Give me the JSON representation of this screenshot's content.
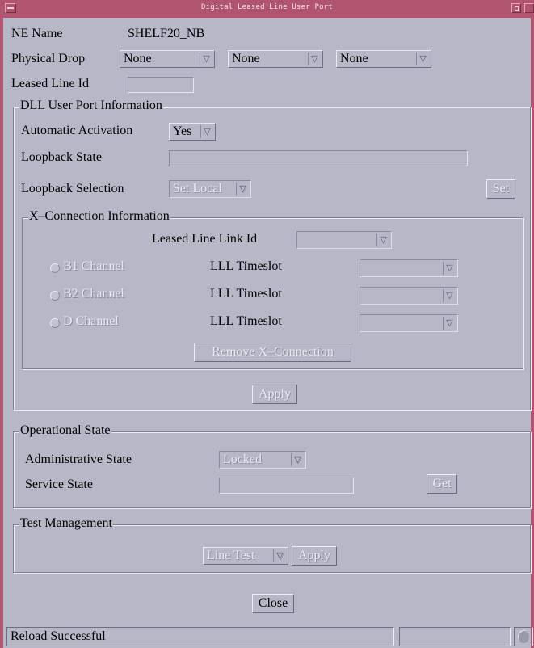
{
  "window": {
    "title": "Digital Leased Line User Port"
  },
  "ne_name": {
    "label": "NE Name",
    "value": "SHELF20_NB"
  },
  "physical_drop": {
    "label": "Physical Drop",
    "options": [
      "None",
      "None",
      "None"
    ]
  },
  "leased_line_id": {
    "label": "Leased Line Id",
    "value": ""
  },
  "dll_user_port": {
    "title": "DLL User Port Information",
    "automatic_activation": {
      "label": "Automatic Activation",
      "value": "Yes"
    },
    "loopback_state": {
      "label": "Loopback State",
      "value": ""
    },
    "loopback_selection": {
      "label": "Loopback Selection",
      "value": "Set Local",
      "set_button": "Set"
    },
    "x_connection": {
      "title": "X–Connection Information",
      "leased_line_link_id": {
        "label": "Leased Line Link Id",
        "value": ""
      },
      "channels": [
        {
          "name": "B1 Channel",
          "timeslot_label": "LLL Timeslot",
          "timeslot_value": ""
        },
        {
          "name": "B2 Channel",
          "timeslot_label": "LLL Timeslot",
          "timeslot_value": ""
        },
        {
          "name": "D Channel",
          "timeslot_label": "LLL Timeslot",
          "timeslot_value": ""
        }
      ],
      "remove_button": "Remove X–Connection"
    },
    "apply_button": "Apply"
  },
  "operational_state": {
    "title": "Operational State",
    "administrative_state": {
      "label": "Administrative State",
      "value": "Locked"
    },
    "service_state": {
      "label": "Service State",
      "value": "",
      "get_button": "Get"
    }
  },
  "test_management": {
    "title": "Test Management",
    "test_type": "Line Test",
    "apply_button": "Apply"
  },
  "close_button": "Close",
  "status": {
    "message": "Reload Successful"
  },
  "icons": {
    "menu": "window-menu-icon",
    "minimize": "minimize-icon",
    "maximize": "maximize-icon",
    "dropdown": "dropdown-arrow-icon",
    "status": "status-indicator-icon"
  },
  "colors": {
    "title_bar": "#b05470",
    "background": "#b7b7c7",
    "disabled_text": "#e8e8f0"
  }
}
